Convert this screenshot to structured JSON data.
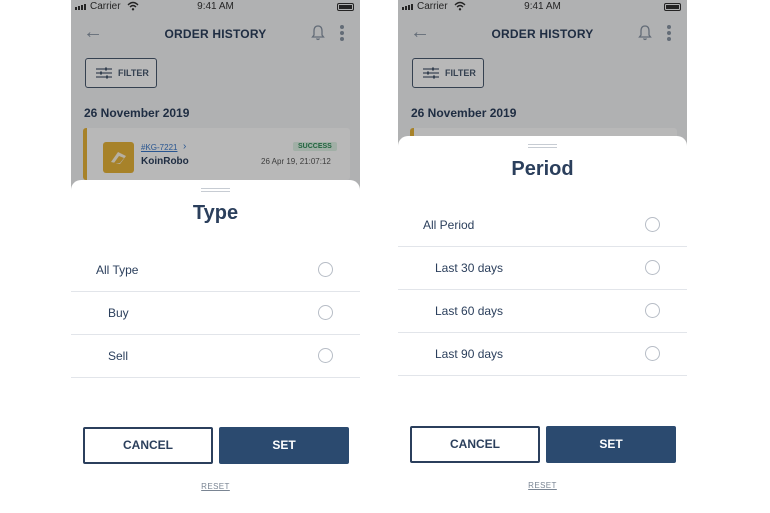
{
  "status_bar": {
    "carrier": "Carrier",
    "time": "9:41 AM"
  },
  "header": {
    "title": "ORDER HISTORY",
    "back_icon": "arrow-left-icon",
    "bell_icon": "bell-icon",
    "menu_icon": "kebab-menu-icon"
  },
  "filter_button": {
    "label": "FILTER"
  },
  "order_group": {
    "date": "26 November 2019",
    "order": {
      "code": "#KG-7221",
      "name": "KoinRobo",
      "status": "SUCCESS",
      "datetime": "26 Apr 19, 21:07:12"
    }
  },
  "colors": {
    "primary": "#2b4a6f",
    "text": "#2b3f5c",
    "accent": "#e8b43a",
    "success": "#2e8b57",
    "success_bg": "#dff3e6"
  },
  "type_sheet": {
    "title": "Type",
    "options": [
      {
        "label": "All Type"
      },
      {
        "label": "Buy"
      },
      {
        "label": "Sell"
      }
    ],
    "cancel_label": "CANCEL",
    "set_label": "SET",
    "reset_label": "RESET"
  },
  "period_sheet": {
    "title": "Period",
    "options": [
      {
        "label": "All Period"
      },
      {
        "label": "Last 30 days"
      },
      {
        "label": "Last 60 days"
      },
      {
        "label": "Last 90 days"
      }
    ],
    "cancel_label": "CANCEL",
    "set_label": "SET",
    "reset_label": "RESET"
  }
}
